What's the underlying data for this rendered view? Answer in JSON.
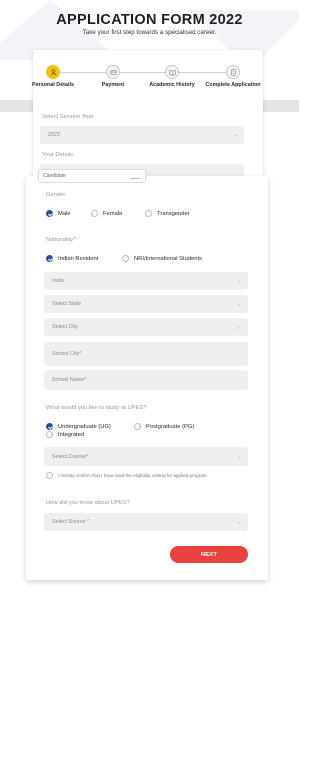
{
  "header": {
    "title": "APPLICATION FORM 2022",
    "subtitle": "Take your first step towards a specialised career."
  },
  "steps": [
    {
      "label": "Personal Details",
      "active": true,
      "icon": "user-icon"
    },
    {
      "label": "Payment",
      "active": false,
      "icon": "card-icon"
    },
    {
      "label": "Academic History",
      "active": false,
      "icon": "book-icon"
    },
    {
      "label": "Complete Application",
      "active": false,
      "icon": "document-icon"
    }
  ],
  "session": {
    "label": "Select Session Year",
    "value": "2022"
  },
  "your_details": {
    "label": "Your Details",
    "partial_input": "Candidate"
  },
  "gender": {
    "label": "Gender",
    "options": [
      "Male",
      "Female",
      "Transgender"
    ],
    "selected": "Male"
  },
  "nationality": {
    "label": "Nationality?",
    "options": [
      "Indian Resident",
      "NRI/International Students"
    ],
    "selected": "Indian Resident",
    "country": "India",
    "state_placeholder": "Select State",
    "city_placeholder": "Select City",
    "school_city_placeholder": "School City*",
    "school_name_placeholder": "School Name*"
  },
  "study": {
    "label": "What would you like to study at UPES?",
    "options": [
      "Undergraduate (UG)",
      "Postgraduate (PG)",
      "Integrated"
    ],
    "selected": "Undergraduate (UG)",
    "course_placeholder": "Select Course*",
    "consent": "I hereby confirm that I have read the eligibility criteria for applied program"
  },
  "source": {
    "label": "How did you know about UPES?",
    "placeholder": "Select Source *"
  },
  "actions": {
    "next_label": "NEXT"
  },
  "colors": {
    "accent_red": "#e8413e",
    "radio_blue": "#1e4fa3",
    "step_active": "#f4c20d"
  }
}
